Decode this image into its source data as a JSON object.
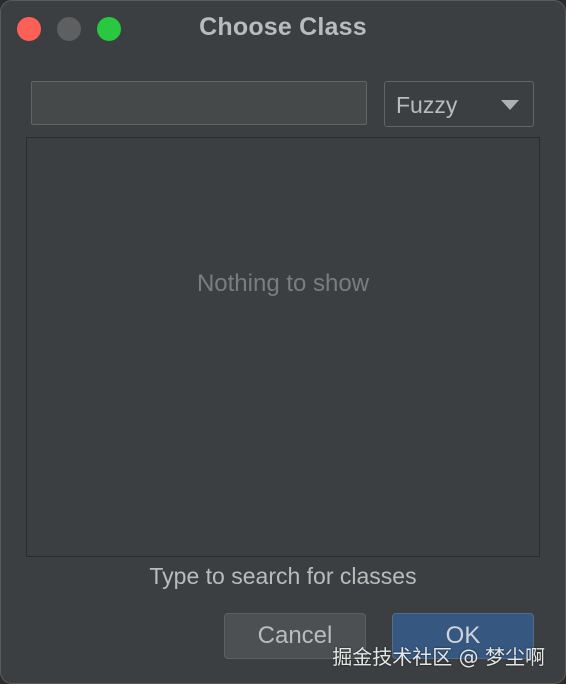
{
  "window": {
    "title": "Choose Class",
    "traffic_lights": {
      "close_color": "#fe5f57",
      "minimize_color": "#5d5f61",
      "zoom_color": "#28c840"
    }
  },
  "search": {
    "value": "",
    "placeholder": ""
  },
  "match_mode": {
    "selected": "Fuzzy"
  },
  "results": {
    "empty_text": "Nothing to show"
  },
  "hint": "Type to search for classes",
  "buttons": {
    "cancel_label": "Cancel",
    "ok_label": "OK"
  },
  "watermark": "掘金技术社区 @ 梦尘啊"
}
